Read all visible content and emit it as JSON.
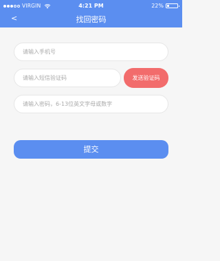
{
  "status_bar": {
    "carrier": "VIRGIN",
    "time": "4:21 PM",
    "battery": "22%",
    "battery_level": 0.22,
    "signal_icon": "signal-dots-icon",
    "wifi_icon": "wifi-icon"
  },
  "nav": {
    "back_label": "<",
    "title": "找回密码"
  },
  "form": {
    "phone_placeholder": "请输入手机号",
    "code_placeholder": "请输入短信验证码",
    "send_code_label": "发送验证码",
    "password_placeholder": "请输入密码，6-13位英文字母或数字",
    "submit_label": "提交"
  },
  "colors": {
    "accent": "#5b8ef0",
    "send_button": "#f26c6c",
    "background": "#f6f6f6"
  }
}
